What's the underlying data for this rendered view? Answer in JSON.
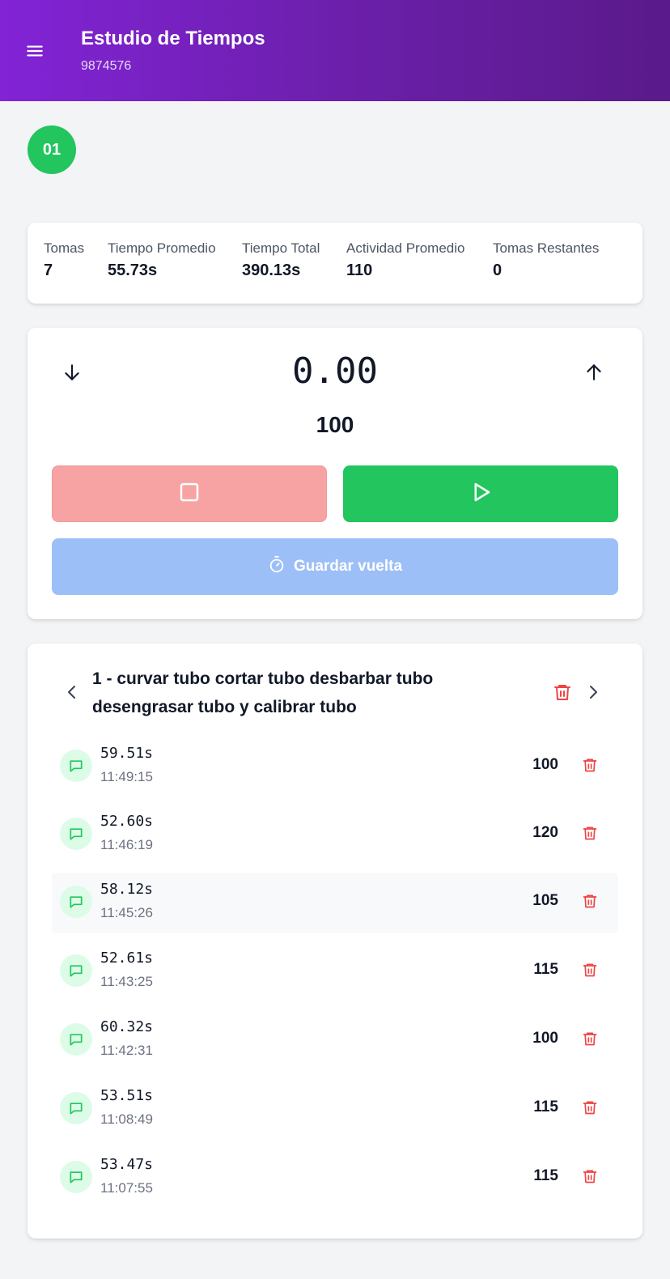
{
  "header": {
    "title": "Estudio de Tiempos",
    "subtitle": "9874576",
    "gradient_from": "#8223d6",
    "gradient_to": "#5a1a8a",
    "menu_icon": "menu-icon"
  },
  "step": {
    "label": "01",
    "color": "#22c55e"
  },
  "stats": [
    {
      "label": "Tomas",
      "value": "7"
    },
    {
      "label": "Tiempo Promedio",
      "value": "55.73s"
    },
    {
      "label": "Tiempo Total",
      "value": "390.13s"
    },
    {
      "label": "Actividad Promedio",
      "value": "110"
    },
    {
      "label": "Tomas Restantes",
      "value": "0"
    }
  ],
  "timer": {
    "display": "0.00",
    "activity": "100",
    "decrease_icon": "arrow-down-icon",
    "increase_icon": "arrow-up-icon",
    "stop_icon": "stop-icon",
    "play_icon": "play-icon",
    "lap_icon": "stopwatch-icon",
    "lap_label": "Guardar vuelta",
    "colors": {
      "stop": "#f7a3a3",
      "play": "#22c55e",
      "lap": "#9dbff7"
    }
  },
  "task": {
    "title": "1 - curvar tubo cortar tubo desbarbar tubo desengrasar tubo y calibrar tubo",
    "prev_icon": "chevron-left-icon",
    "next_icon": "chevron-right-icon",
    "delete_icon": "trash-icon"
  },
  "laps": [
    {
      "time": "59.51s",
      "clock": "11:49:15",
      "activity": "100"
    },
    {
      "time": "52.60s",
      "clock": "11:46:19",
      "activity": "120"
    },
    {
      "time": "58.12s",
      "clock": "11:45:26",
      "activity": "105"
    },
    {
      "time": "52.61s",
      "clock": "11:43:25",
      "activity": "115"
    },
    {
      "time": "60.32s",
      "clock": "11:42:31",
      "activity": "100"
    },
    {
      "time": "53.51s",
      "clock": "11:08:49",
      "activity": "115"
    },
    {
      "time": "53.47s",
      "clock": "11:07:55",
      "activity": "115"
    }
  ]
}
